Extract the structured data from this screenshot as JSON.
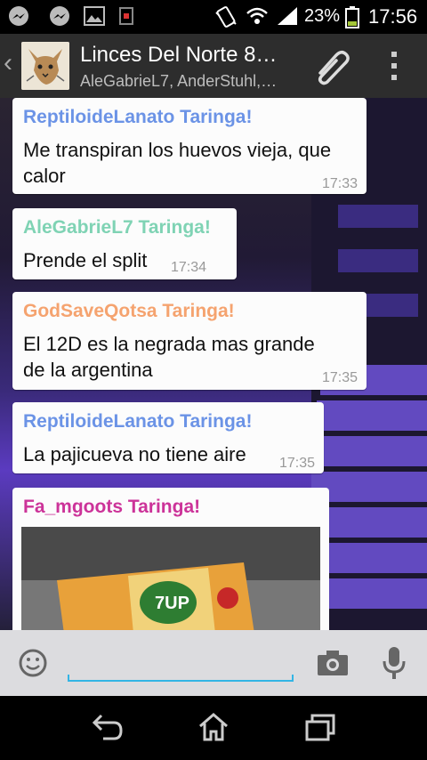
{
  "status_bar": {
    "battery_percent": "23%",
    "time": "17:56",
    "icons": [
      "messenger-icon",
      "messenger-icon",
      "gallery-icon",
      "sim-icon",
      "vibrate-icon",
      "wifi-icon",
      "signal-icon",
      "battery-icon"
    ]
  },
  "header": {
    "title": "Linces Del Norte  8…",
    "members": "AleGabrieL7, AnderStuhl,…",
    "icons": [
      "back-icon",
      "lynx-avatar",
      "paperclip-icon",
      "overflow-menu-icon"
    ]
  },
  "messages": [
    {
      "sender": "ReptiloideLanato Taringa!",
      "text_lines": [
        "Me transpiran los huevos vieja, que",
        "calor"
      ],
      "time": "17:33",
      "color": "#6b93e6"
    },
    {
      "sender": "AleGabrieL7 Taringa!",
      "text_lines": [
        "Prende el split"
      ],
      "time": "17:34",
      "color": "#7fd3b4"
    },
    {
      "sender": "GodSaveQotsa Taringa!",
      "text_lines": [
        "El 12D es la negrada mas grande",
        "de la argentina"
      ],
      "time": "17:35",
      "color": "#f5a36f"
    },
    {
      "sender": "ReptiloideLanato Taringa!",
      "text_lines": [
        "La pajicueva no tiene aire"
      ],
      "time": "17:35",
      "color": "#6b93e6"
    },
    {
      "sender": "Fa_mgoots Taringa!",
      "time": "",
      "color": "#cc3399",
      "has_photo": true
    }
  ],
  "input_bar": {
    "icons": [
      "emoji-icon",
      "camera-icon",
      "microphone-icon"
    ],
    "accent": "#33b5e5"
  },
  "nav_bar": {
    "icons": [
      "back-nav-icon",
      "home-icon",
      "recent-apps-icon"
    ]
  }
}
